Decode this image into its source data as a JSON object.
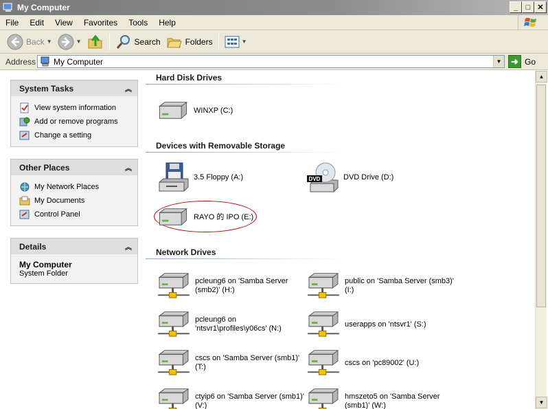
{
  "window": {
    "title": "My Computer"
  },
  "menu": [
    "File",
    "Edit",
    "View",
    "Favorites",
    "Tools",
    "Help"
  ],
  "toolbar": {
    "back": "Back",
    "search": "Search",
    "folders": "Folders"
  },
  "address": {
    "label": "Address",
    "value": "My Computer",
    "go": "Go"
  },
  "left": {
    "system_tasks": {
      "title": "System Tasks",
      "items": [
        "View system information",
        "Add or remove programs",
        "Change a setting"
      ]
    },
    "other_places": {
      "title": "Other Places",
      "items": [
        "My Network Places",
        "My Documents",
        "Control Panel"
      ]
    },
    "details": {
      "title": "Details",
      "name": "My Computer",
      "type": "System Folder"
    }
  },
  "groups": {
    "hard_disk": "Hard Disk Drives",
    "removable": "Devices with Removable Storage",
    "network": "Network Drives"
  },
  "drives": {
    "winxp": "WINXP (C:)",
    "floppy": "3.5 Floppy (A:)",
    "dvd": "DVD Drive (D:)",
    "rayo": "RAYO 的 IPO (E:)",
    "net": [
      [
        "pcleung6 on 'Samba Server",
        "(smb2)' (H:)"
      ],
      [
        "public on 'Samba Server (smb3)'",
        "(I:)"
      ],
      [
        "pcleung6 on",
        "'ntsvr1\\profiles\\y06cs' (N:)"
      ],
      [
        "userapps on 'ntsvr1' (S:)"
      ],
      [
        "cscs on 'Samba Server (smb1)'",
        "(T:)"
      ],
      [
        "cscs on 'pc89002' (U:)"
      ],
      [
        "ctyip6 on 'Samba Server (smb1)'",
        "(V:)"
      ],
      [
        "hmszeto5 on 'Samba Server",
        "(smb1)' (W:)"
      ]
    ]
  },
  "dvd_badge": "DVD"
}
